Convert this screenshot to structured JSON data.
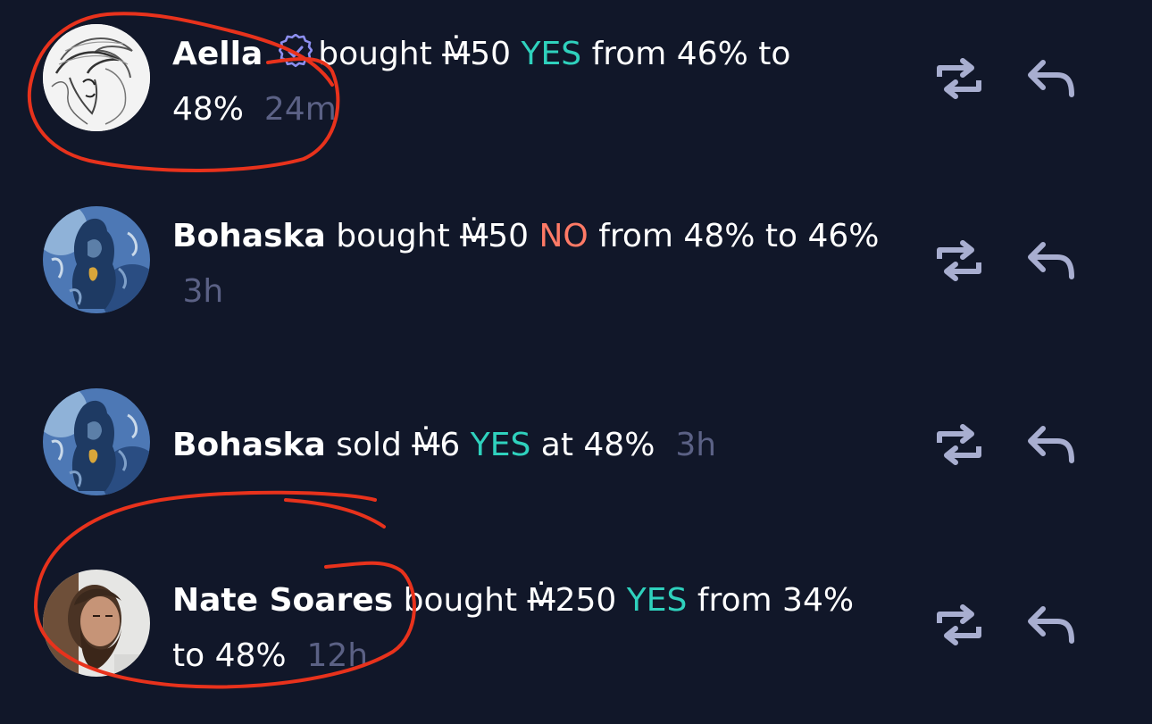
{
  "feed": {
    "items": [
      {
        "user": "Aella",
        "verified": true,
        "verb": "bought",
        "mana_symbol": "Ṁ",
        "amount": "50",
        "outcome": "YES",
        "outcome_color": "#2fd1bd",
        "mid": "from 46% to",
        "end": "48%",
        "time": "24m"
      },
      {
        "user": "Bohaska",
        "verified": false,
        "verb": "bought",
        "mana_symbol": "Ṁ",
        "amount": "50",
        "outcome": "NO",
        "outcome_color": "#ff7a66",
        "mid": "from 48% to 46%",
        "time": "3h"
      },
      {
        "user": "Bohaska",
        "verified": false,
        "verb": "sold",
        "mana_symbol": "Ṁ",
        "amount": "6",
        "outcome": "YES",
        "outcome_color": "#2fd1bd",
        "mid": "at 48%",
        "time": "3h"
      },
      {
        "user": "Nate Soares",
        "verified": false,
        "verb": "bought",
        "mana_symbol": "Ṁ",
        "amount": "250",
        "outcome": "YES",
        "outcome_color": "#2fd1bd",
        "mid": "from 34%",
        "end": "to 48%",
        "time": "12h"
      }
    ],
    "icons": {
      "repost": "repost-icon",
      "reply": "reply-icon",
      "verified": "verified-badge-icon"
    },
    "colors": {
      "background": "#111729",
      "yes": "#2fd1bd",
      "no": "#ff7a66",
      "time": "#5b6185",
      "icon": "#a8aed0",
      "annotation": "#e8321c"
    }
  }
}
